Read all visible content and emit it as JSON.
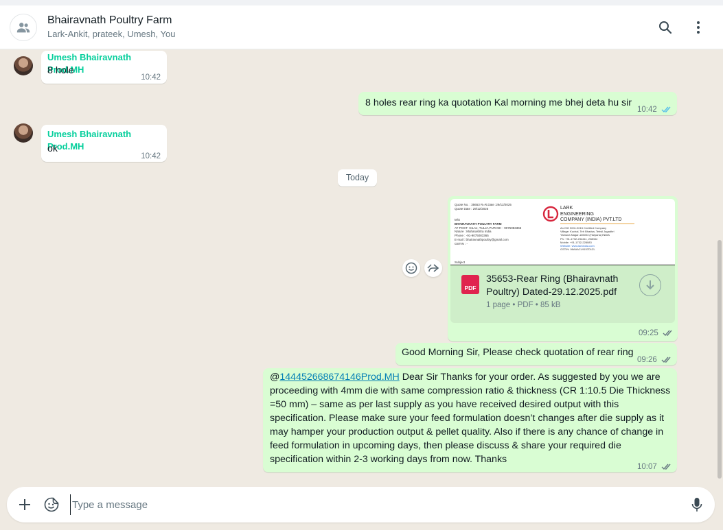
{
  "header": {
    "title": "Bhairavnath Poultry Farm",
    "subtitle": "Lark-Ankit, prateek, Umesh, You",
    "icons": [
      "group-icon",
      "search-icon",
      "menu-icon"
    ]
  },
  "day_chip": "Today",
  "messages": [
    {
      "direction": "in",
      "sender": "Umesh Bhairavnath Prod.MH",
      "text": "8 hole",
      "time": "10:42"
    },
    {
      "direction": "out",
      "text": "8 holes rear ring ka quotation Kal morning me bhej deta hu sir",
      "time": "10:42",
      "status": "read"
    },
    {
      "direction": "in",
      "sender": "Umesh Bhairavnath Prod.MH",
      "text": "ok",
      "time": "10:42"
    },
    {
      "direction": "out",
      "type": "document",
      "time": "09:25",
      "status": "delivered",
      "document": {
        "name": "35653-Rear Ring (Bhairavnath Poultry) Dated-29.12.2025.pdf",
        "meta": "1 page • PDF • 85 kB",
        "badge": "PDF",
        "preview": {
          "quote_line": "Quote No. : 35653  R=R.Date :29/12/2025",
          "quote_date": "Quote Date : 29/12/2025",
          "company_lines": [
            "LARK",
            "ENGINEERING",
            "COMPANY (INDIA) PVT.LTD"
          ],
          "to_lines": [
            "M/S",
            "BHAIRAVNATH POULTRY FARM",
            "AT POST- KILAJ, TULJA PUR MH - 9075083365",
            "Nature : Maharashtra  India",
            "Phone : -91-9075083365",
            "E-mail : bhairavnathpoultry@gmail.com",
            "GSTIN : -"
          ],
          "addr_lines": [
            "An ISO 9001:2015 Certified Company",
            "Village: Kuchal, Teh Bhadsa, Tehsil Jagadhri",
            "Yamuna Nagar-135003 (Haryana) INDIA",
            "Ph: +91-1732-234411, 228084",
            "Mobile: +91-1732-228083",
            "Website: www.larkindia.com",
            "GSTIN: 06AAACL9157D1ZL"
          ],
          "subject": "Subject"
        }
      }
    },
    {
      "direction": "out",
      "text": "Good Morning Sir, Please check quotation of rear ring",
      "time": "09:26",
      "status": "delivered"
    },
    {
      "direction": "out",
      "time": "10:07",
      "status": "delivered",
      "mention_prefix": "@",
      "mention": "144452668674146Prod.MH",
      "text": " Dear Sir Thanks for your order. As suggested by you we are proceeding with  4mm die with same compression ratio & thickness (CR 1:10.5 Die Thickness =50 mm) – same as per last supply as you have received desired output with this specification. Please make sure your feed formulation doesn’t changes after die supply as it may hamper your production output & pellet quality. Also if there is any chance of change in feed formulation in upcoming days, then please discuss & share your required die specification within 2-3 working days from now. Thanks"
    }
  ],
  "composer": {
    "placeholder": "Type a message"
  },
  "colors": {
    "outgoing": "#d9fdd3",
    "incoming": "#ffffff",
    "sender": "#06cf9c",
    "read_tick": "#53bdeb",
    "background": "#efeae2"
  }
}
